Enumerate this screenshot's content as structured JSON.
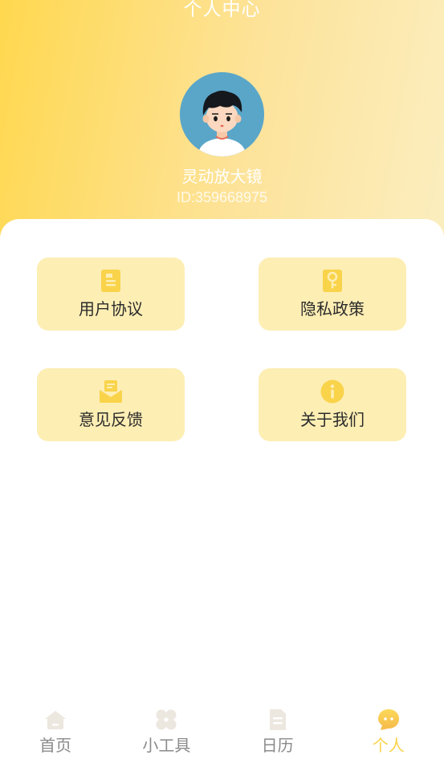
{
  "header": {
    "title": "个人中心",
    "username": "灵动放大镜",
    "user_id": "ID:359668975"
  },
  "menu": {
    "items": [
      {
        "label": "用户协议",
        "icon": "document-icon"
      },
      {
        "label": "隐私政策",
        "icon": "key-icon"
      },
      {
        "label": "意见反馈",
        "icon": "envelope-icon"
      },
      {
        "label": "关于我们",
        "icon": "info-icon"
      }
    ]
  },
  "tabbar": {
    "items": [
      {
        "label": "首页",
        "icon": "home-icon",
        "active": false
      },
      {
        "label": "小工具",
        "icon": "tools-icon",
        "active": false
      },
      {
        "label": "日历",
        "icon": "calendar-doc-icon",
        "active": false
      },
      {
        "label": "个人",
        "icon": "chat-bubble-icon",
        "active": true
      }
    ]
  },
  "colors": {
    "accent": "#f9d34a",
    "tile_bg": "#fdeeb4",
    "header_start": "#ffd84f",
    "header_end": "#fbeebf",
    "inactive_icon": "#ece7df"
  }
}
